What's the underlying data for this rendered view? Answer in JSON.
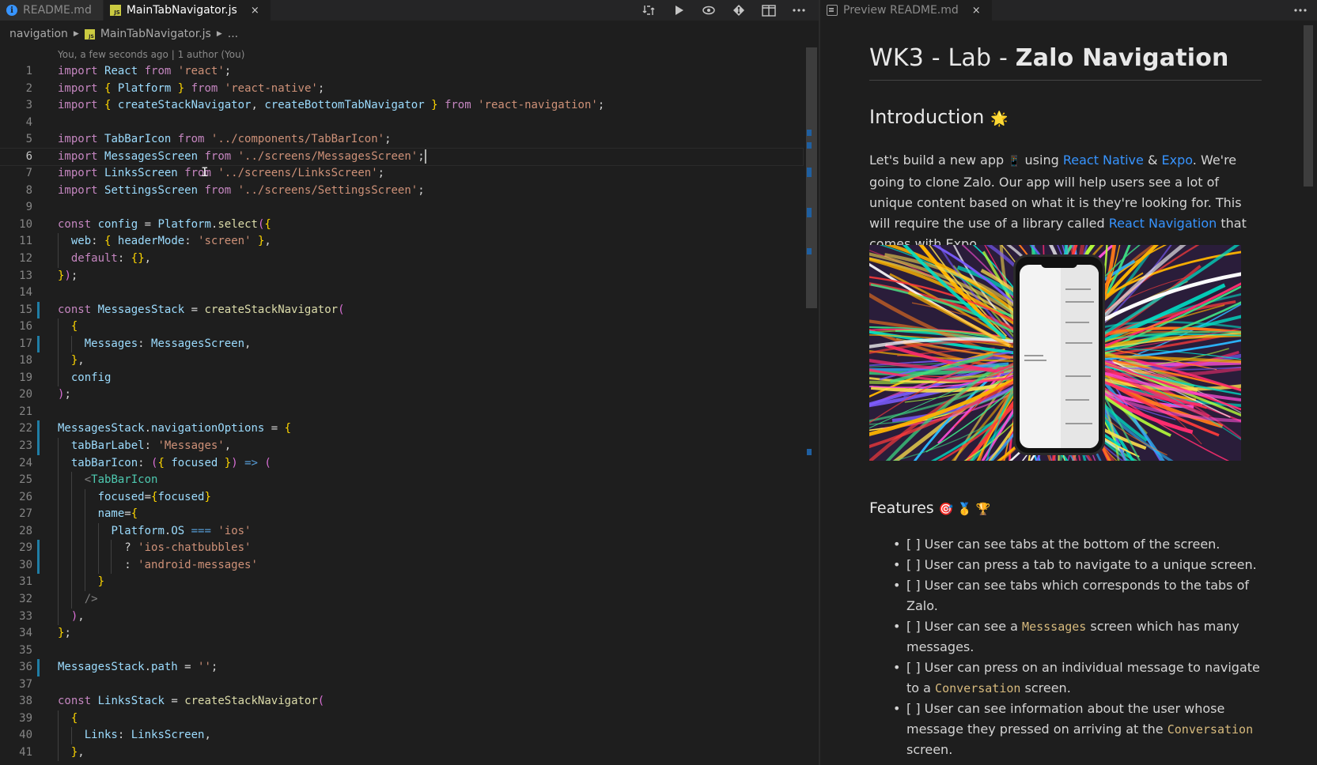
{
  "left_tabs": [
    {
      "label": "README.md",
      "icon": "info-icon",
      "active": false
    },
    {
      "label": "MainTabNavigator.js",
      "icon": "js-file-icon",
      "active": true,
      "close": "×"
    }
  ],
  "editor_actions": [
    "compare-changes-icon",
    "run-icon",
    "toggle-blame-icon",
    "git-icon",
    "split-editor-icon",
    "more-actions-icon"
  ],
  "right_tabs": [
    {
      "label": "Preview README.md",
      "icon": "preview-icon",
      "close": "×"
    }
  ],
  "breadcrumb": {
    "folder": "navigation",
    "file": "MainTabNavigator.js",
    "tail": "..."
  },
  "blame": "You, a few seconds ago | 1 author (You)",
  "cursor_line": 6,
  "code": {
    "l1": "import React from 'react';",
    "l2": "import { Platform } from 'react-native';",
    "l3": "import { createStackNavigator, createBottomTabNavigator } from 'react-navigation';",
    "l5": "import TabBarIcon from '../components/TabBarIcon';",
    "l6": "import MessagesScreen from '../screens/MessagesScreen';",
    "l7": "import LinksScreen from '../screens/LinksScreen';",
    "l8": "import SettingsScreen from '../screens/SettingsScreen';",
    "l10": "const config = Platform.select({",
    "l11": "  web: { headerMode: 'screen' },",
    "l12": "  default: {},",
    "l13": "});",
    "l15": "const MessagesStack = createStackNavigator(",
    "l16": "  {",
    "l17": "    Messages: MessagesScreen,",
    "l18": "  },",
    "l19": "  config",
    "l20": ");",
    "l22": "MessagesStack.navigationOptions = {",
    "l23": "  tabBarLabel: 'Messages',",
    "l24": "  tabBarIcon: ({ focused }) => (",
    "l25": "    <TabBarIcon",
    "l26": "      focused={focused}",
    "l27": "      name={",
    "l28": "        Platform.OS === 'ios'",
    "l29": "          ? 'ios-chatbubbles'",
    "l30": "          : 'android-messages'",
    "l31": "      }",
    "l32": "    />",
    "l33": "  ),",
    "l34": "};",
    "l36": "MessagesStack.path = '';",
    "l38": "const LinksStack = createStackNavigator(",
    "l39": "  {",
    "l40": "    Links: LinksScreen,",
    "l41": "  },"
  },
  "modified_lines": [
    15,
    17,
    22,
    23,
    29,
    30,
    36
  ],
  "preview": {
    "h1_prefix": "WK3 - Lab - ",
    "h1_bold": "Zalo Navigation",
    "intro_heading": "Introduction",
    "intro_emoji": "🌟",
    "intro_p1": "Let's build a new app",
    "intro_p1_emoji": "📱",
    "intro_p2": " using ",
    "link_react_native": "React Native",
    "amp": " & ",
    "link_expo": "Expo",
    "intro_p3": ". We're going to clone Zalo. Our app will help users see a lot of unique content based on what it is they're looking for. This will require the use of a library called ",
    "link_react_navigation": "React Navigation",
    "intro_p4": " that comes with Expo.",
    "features_heading": "Features",
    "features_emoji": "🎯 🥇 🏆",
    "features": [
      {
        "text": "[ ] User can see tabs at the bottom of the screen."
      },
      {
        "text": "[ ] User can press a tab to navigate to a unique screen."
      },
      {
        "text": "[ ] User can see tabs which corresponds to the tabs of Zalo."
      },
      {
        "pre": "[ ] User can see a ",
        "code": "Messsages",
        "post": " screen which has many messages."
      },
      {
        "pre": "[ ] User can press on an individual message to navigate to a ",
        "code": "Conversation",
        "post": " screen."
      },
      {
        "pre": "[ ] User can see information about the user whose message they pressed on arriving at the ",
        "code": "Conversation",
        "post": " screen."
      }
    ],
    "colors": {
      "link": "#3794ff",
      "code": "#d7ba7d"
    }
  }
}
